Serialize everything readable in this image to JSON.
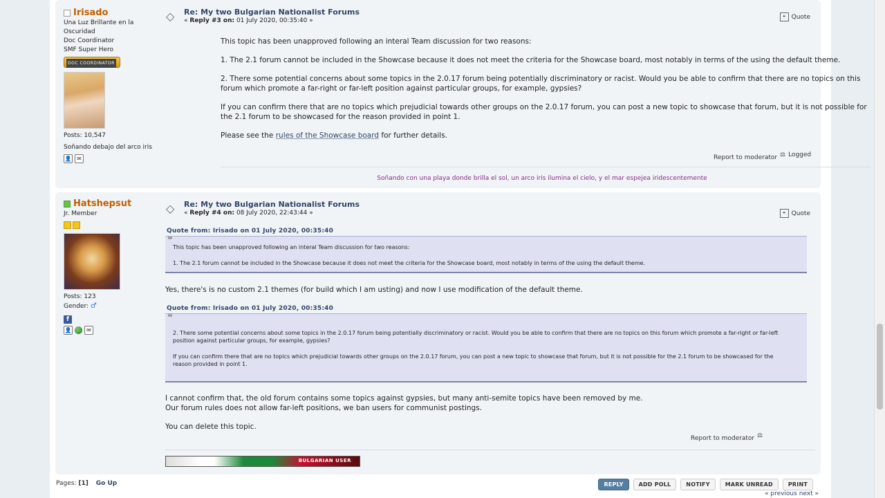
{
  "post1": {
    "poster": {
      "name": "Irisado",
      "lines": [
        "Una Luz Brillante en la Oscuridad",
        "Doc Coordinator",
        "SMF Super Hero"
      ],
      "badge": "DOC COORDINATOR",
      "posts": "Posts: 10,547",
      "signature_short": "Soñando debajo del arco iris"
    },
    "subject": "Re: My two Bulgarian Nationalist Forums",
    "meta_prefix": "«",
    "meta_reply": "Reply #3 on:",
    "meta_date": "01 July 2020, 00:35:40 »",
    "quote_label": "Quote",
    "paragraphs": [
      "This topic has been unapproved following an interal Team discussion for two reasons:",
      "1. The 2.1 forum cannot be included in the Showcase because it does not meet the criteria for the Showcase board, most notably in terms of the using the default theme.",
      "2. There some potential concerns about some topics in the 2.0.17 forum being potentially discriminatory or racist.  Would you be able to confirm that there are no topics on this forum which promote a far-right or far-left position against particular groups, for example, gypsies?",
      "If you can confirm there that are no topics which prejudicial towards other groups on the 2.0.17 forum, you can post a new topic to showcase that forum, but it is not possible for the 2.1 forum to be showcased for the reason provided in point 1."
    ],
    "last_prefix": "Please see the ",
    "last_link": "rules of the Showcase board",
    "last_suffix": " for further details.",
    "report": "Report to moderator",
    "logged": "Logged",
    "signature": "Soñando con una playa donde brilla el sol, un arco iris ilumina el cielo, y el mar espejea iridescentemente"
  },
  "post2": {
    "poster": {
      "name": "Hatshepsut",
      "rank": "Jr. Member",
      "posts": "Posts: 123",
      "gender": "Gender:"
    },
    "subject": "Re: My two Bulgarian Nationalist Forums",
    "meta_prefix": "«",
    "meta_reply": "Reply #4 on:",
    "meta_date": "08 July 2020, 22:43:44 »",
    "quote_label": "Quote",
    "quote1_header": "Quote from: Irisado on 01 July 2020, 00:35:40",
    "quote1": [
      "This topic has been unapproved following an interal Team discussion for two reasons:",
      "1. The 2.1 forum cannot be included in the Showcase because it does not meet the criteria for the Showcase board, most notably in terms of the using the default theme."
    ],
    "reply1": "Yes, there's is no custom 2.1 themes (for build which I am usting) and now I use modification of the default theme.",
    "quote2_header": "Quote from: Irisado on 01 July 2020, 00:35:40",
    "quote2": [
      "2. There some potential concerns about some topics in the 2.0.17 forum being potentially discriminatory or racist.  Would you be able to confirm that there are no topics on this forum which promote a far-right or far-left position against particular groups, for example, gypsies?",
      "If you can confirm there that are no topics which prejudicial towards other groups on the 2.0.17 forum, you can post a new topic to showcase that forum, but it is not possible for the 2.1 forum to be showcased for the reason provided in point 1."
    ],
    "reply2_line1": "I cannot confirm that, the old forum contains some topics against gypsies, but many anti-semite topics have been removed by me.",
    "reply2_line2": "Our forum rules does not allow far-left positions, we ban users for communist postings.",
    "reply3": "You can delete this topic.",
    "report": "Report to moderator",
    "sig_banner": "BULGARIAN  USER"
  },
  "footer": {
    "pages_label": "Pages:",
    "current_page": "[1]",
    "go_up": "Go Up",
    "buttons": [
      "REPLY",
      "ADD POLL",
      "NOTIFY",
      "MARK UNREAD",
      "PRINT"
    ],
    "prevnext": "« previous next »"
  },
  "colors": {
    "poster_name": "#c06002",
    "subject": "#334466",
    "signature": "#8a2a8a",
    "quote_bg": "#dfe1f2",
    "reply_button": "#557ea0"
  },
  "icons": [
    "topic-icon",
    "quote-icon",
    "profile-icon",
    "pm-icon",
    "facebook-icon",
    "website-icon",
    "logged-icon",
    "male-gender-icon"
  ]
}
